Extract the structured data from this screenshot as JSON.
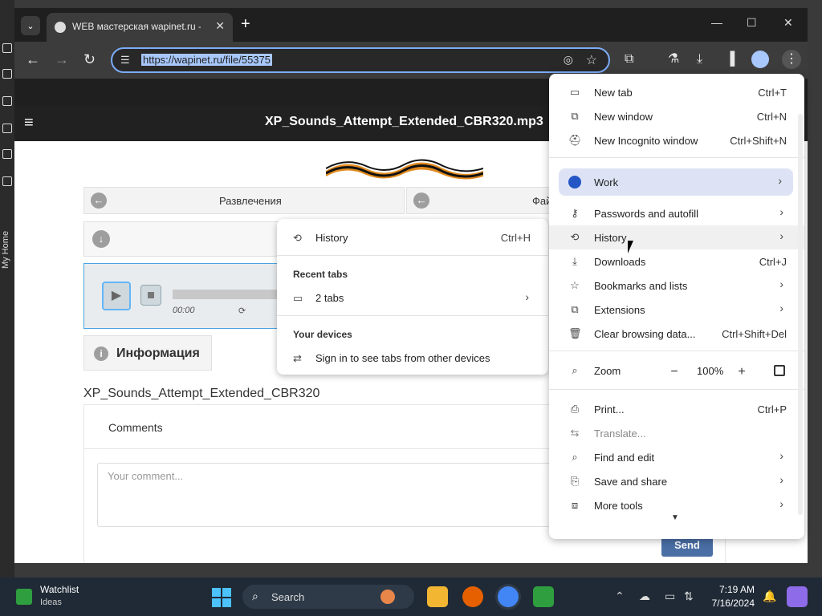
{
  "browser": {
    "tab_title": "WEB мастерская wapinet.ru -",
    "url": "https://wapinet.ru/file/55375",
    "new_tab_symbol": "+",
    "tab_close_symbol": "✕"
  },
  "page": {
    "title": "XP_Sounds_Attempt_Extended_CBR320.mp3",
    "nav_left_label": "Развлечения",
    "nav_right_label": "Фай",
    "player_time": "00:00",
    "info_label": "Информация",
    "file_name": "XP_Sounds_Attempt_Extended_CBR320",
    "comments_header": "Comments",
    "comment_placeholder": "Your comment...",
    "send_label": "Send"
  },
  "history_submenu": {
    "history_label": "History",
    "history_shortcut": "Ctrl+H",
    "recent_tabs_header": "Recent tabs",
    "recent_tabs_item": "2 tabs",
    "your_devices_header": "Your devices",
    "sign_in_item": "Sign in to see tabs from other devices"
  },
  "menu": {
    "new_tab": "New tab",
    "new_tab_sc": "Ctrl+T",
    "new_window": "New window",
    "new_window_sc": "Ctrl+N",
    "incognito": "New Incognito window",
    "incognito_sc": "Ctrl+Shift+N",
    "work": "Work",
    "passwords": "Passwords and autofill",
    "history": "History",
    "downloads": "Downloads",
    "downloads_sc": "Ctrl+J",
    "bookmarks": "Bookmarks and lists",
    "extensions": "Extensions",
    "clear": "Clear browsing data...",
    "clear_sc": "Ctrl+Shift+Del",
    "zoom": "Zoom",
    "zoom_value": "100%",
    "zoom_minus": "−",
    "zoom_plus": "+",
    "print": "Print...",
    "print_sc": "Ctrl+P",
    "translate": "Translate...",
    "find": "Find and edit",
    "save_share": "Save and share",
    "more_tools": "More tools"
  },
  "taskbar": {
    "widget_title": "Watchlist",
    "widget_sub": "Ideas",
    "search_label": "Search",
    "time": "7:19 AM",
    "date": "7/16/2024"
  },
  "desktop": {
    "side_label": "My Home"
  },
  "colors": {
    "accent": "#a8c7fa",
    "work_highlight": "#dde3f5",
    "send_button": "#4a6fa5"
  }
}
